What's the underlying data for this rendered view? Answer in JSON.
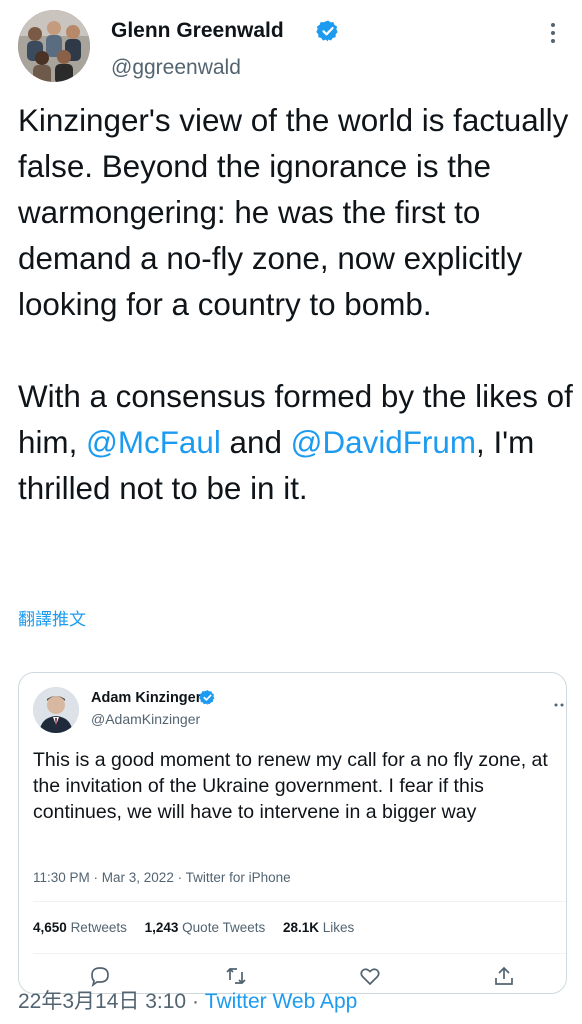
{
  "author": {
    "name": "Glenn Greenwald",
    "handle": "@ggreenwald",
    "verified": true,
    "avatar": "group-photo-avatar"
  },
  "tweet": {
    "paragraph1": "Kinzinger's view of the world is factually false. Beyond the ignorance is the warmongering: he was the first to demand a no-fly zone, now explicitly looking for a country to bomb.",
    "paragraph2_before": "With a consensus formed by the likes of him, ",
    "mention1": "@McFaul",
    "paragraph2_middle": " and ",
    "mention2": "@DavidFrum",
    "paragraph2_after": ", I'm thrilled not to be in it.",
    "translate_label": "翻譯推文"
  },
  "quoted": {
    "name": "Adam Kinzinger",
    "handle": "@AdamKinzinger",
    "verified": true,
    "text": "This is a good moment to renew my call for a no fly zone, at the invitation of the Ukraine government.  I fear if this continues, we will have to intervene in a bigger way",
    "meta": "11:30 PM · Mar 3, 2022 · Twitter for iPhone",
    "stats": {
      "retweets_count": "4,650",
      "retweets_label": "Retweets",
      "quotes_count": "1,243",
      "quotes_label": "Quote Tweets",
      "likes_count": "28.1K",
      "likes_label": "Likes"
    }
  },
  "footer": {
    "timestamp": "22年3月14日 3:10",
    "separator": " · ",
    "source": "Twitter Web App"
  },
  "colors": {
    "accent": "#1d9bf0",
    "text": "#0f1419",
    "secondary": "#536471",
    "border": "#cfd9de"
  }
}
